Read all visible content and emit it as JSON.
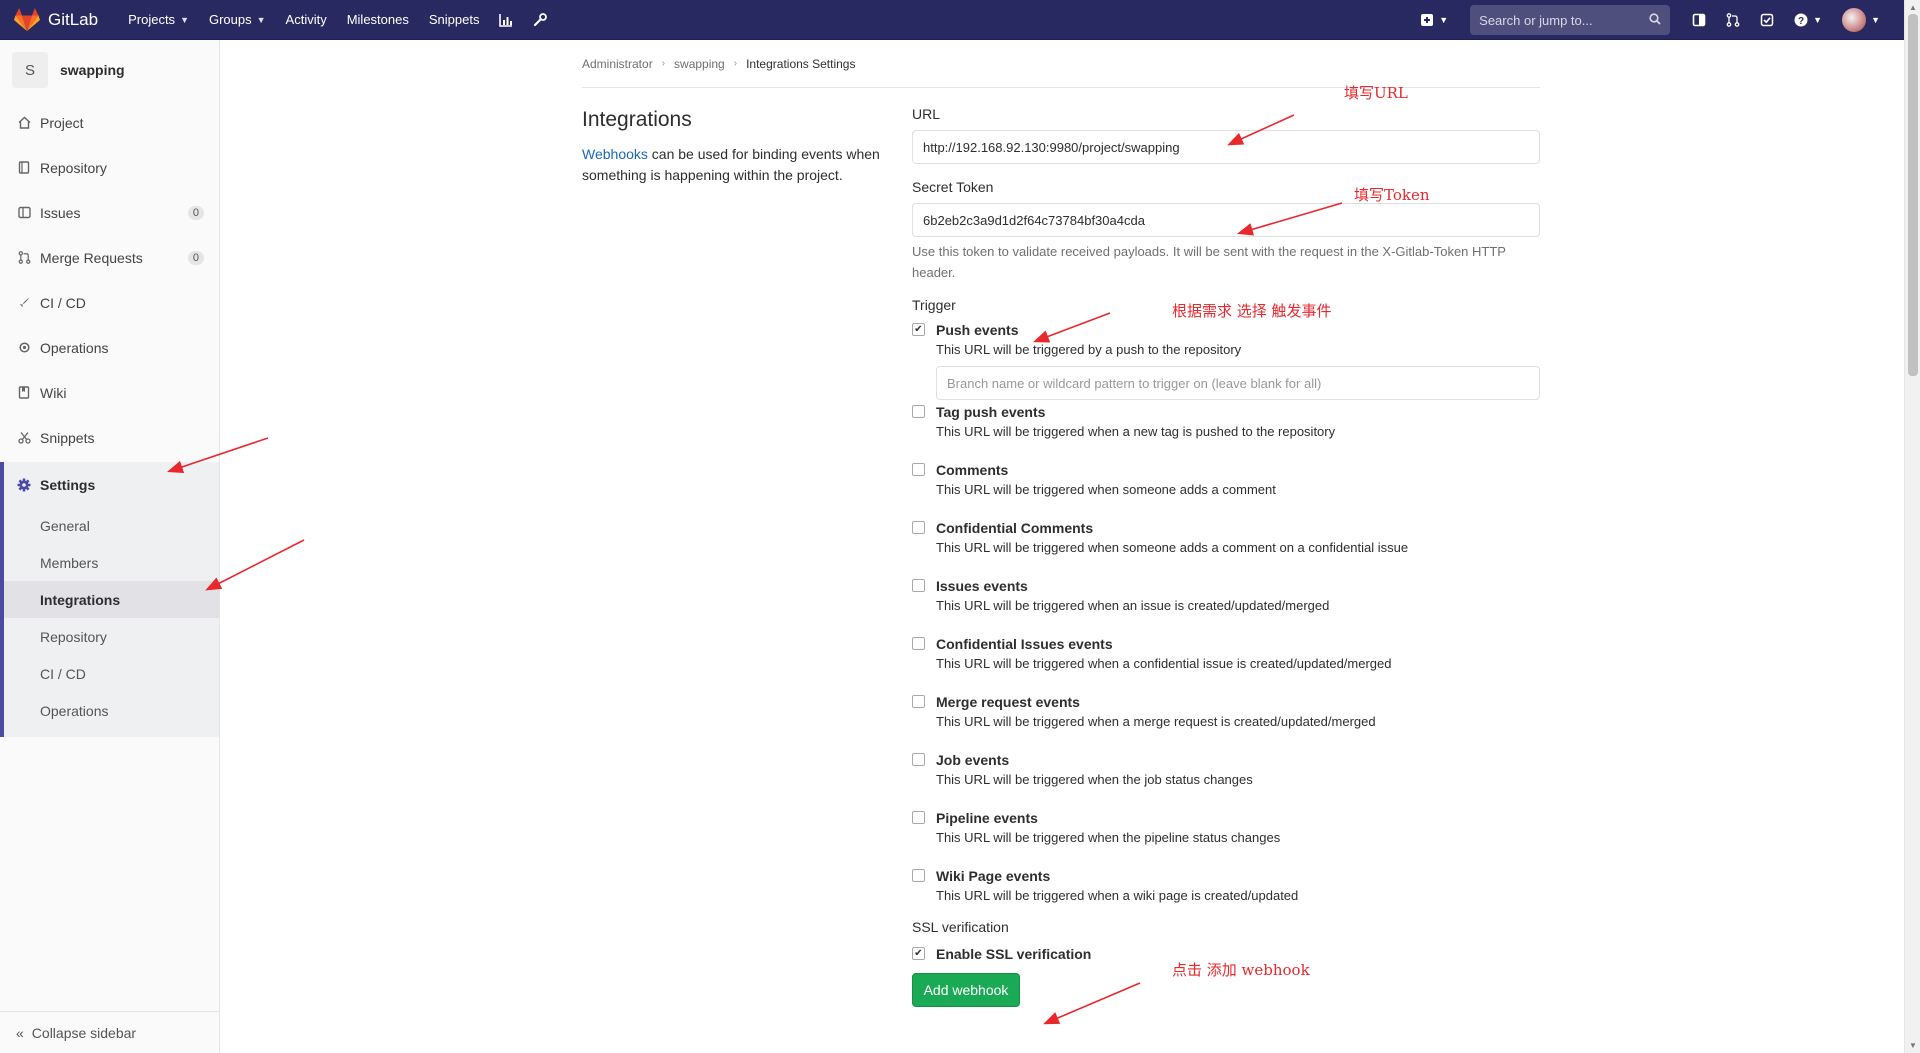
{
  "navbar": {
    "brand": "GitLab",
    "links": [
      "Projects",
      "Groups",
      "Activity",
      "Milestones",
      "Snippets"
    ],
    "search_placeholder": "Search or jump to..."
  },
  "sidebar": {
    "project_initial": "S",
    "project_name": "swapping",
    "items": [
      {
        "label": "Project",
        "icon": "home-icon"
      },
      {
        "label": "Repository",
        "icon": "book-icon"
      },
      {
        "label": "Issues",
        "icon": "issues-icon",
        "count": "0"
      },
      {
        "label": "Merge Requests",
        "icon": "merge-request-icon",
        "count": "0"
      },
      {
        "label": "CI / CD",
        "icon": "rocket-icon"
      },
      {
        "label": "Operations",
        "icon": "cloud-gear-icon"
      },
      {
        "label": "Wiki",
        "icon": "wiki-icon"
      },
      {
        "label": "Snippets",
        "icon": "scissors-icon"
      }
    ],
    "settings_label": "Settings",
    "settings_sub": [
      "General",
      "Members",
      "Integrations",
      "Repository",
      "CI / CD",
      "Operations"
    ],
    "collapse_label": "Collapse sidebar"
  },
  "breadcrumb": [
    "Administrator",
    "swapping",
    "Integrations Settings"
  ],
  "intro": {
    "title": "Integrations",
    "link_text": "Webhooks",
    "text": " can be used for binding events when something is happening within the project."
  },
  "form": {
    "url_label": "URL",
    "url_value": "http://192.168.92.130:9980/project/swapping",
    "token_label": "Secret Token",
    "token_value": "6b2eb2c3a9d1d2f64c73784bf30a4cda",
    "token_help": "Use this token to validate received payloads. It will be sent with the request in the X-Gitlab-Token HTTP header.",
    "trigger_label": "Trigger",
    "branch_placeholder": "Branch name or wildcard pattern to trigger on (leave blank for all)",
    "events": [
      {
        "name": "Push events",
        "desc": "This URL will be triggered by a push to the repository",
        "checked": true
      },
      {
        "name": "Tag push events",
        "desc": "This URL will be triggered when a new tag is pushed to the repository",
        "checked": false
      },
      {
        "name": "Comments",
        "desc": "This URL will be triggered when someone adds a comment",
        "checked": false
      },
      {
        "name": "Confidential Comments",
        "desc": "This URL will be triggered when someone adds a comment on a confidential issue",
        "checked": false
      },
      {
        "name": "Issues events",
        "desc": "This URL will be triggered when an issue is created/updated/merged",
        "checked": false
      },
      {
        "name": "Confidential Issues events",
        "desc": "This URL will be triggered when a confidential issue is created/updated/merged",
        "checked": false
      },
      {
        "name": "Merge request events",
        "desc": "This URL will be triggered when a merge request is created/updated/merged",
        "checked": false
      },
      {
        "name": "Job events",
        "desc": "This URL will be triggered when the job status changes",
        "checked": false
      },
      {
        "name": "Pipeline events",
        "desc": "This URL will be triggered when the pipeline status changes",
        "checked": false
      },
      {
        "name": "Wiki Page events",
        "desc": "This URL will be triggered when a wiki page is created/updated",
        "checked": false
      }
    ],
    "ssl_label": "SSL verification",
    "ssl_checkbox": "Enable SSL verification",
    "ssl_checked": true,
    "submit_label": "Add webhook"
  },
  "annotations": {
    "url": "填写URL",
    "token": "填写Token",
    "trigger": "根据需求  选择  触发事件",
    "submit": "点击  添加  webhook"
  },
  "colors": {
    "navbar": "#292961",
    "accent": "#4b4ba3",
    "link": "#1b69b6",
    "success": "#1aaa55",
    "annotation": "#e8282d"
  }
}
